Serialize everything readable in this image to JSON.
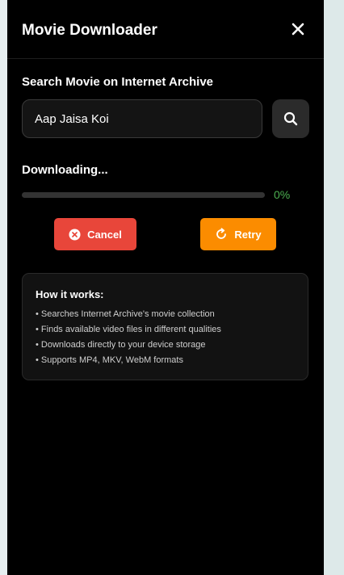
{
  "app": {
    "title": "Movie Downloader"
  },
  "search": {
    "label": "Search Movie on Internet Archive",
    "value": "Aap Jaisa Koi"
  },
  "download": {
    "status": "Downloading...",
    "progress_percent": 0,
    "progress_text": "0%"
  },
  "actions": {
    "cancel_label": "Cancel",
    "retry_label": "Retry"
  },
  "info": {
    "title": "How it works:",
    "items": [
      "• Searches Internet Archive's movie collection",
      "• Finds available video files in different qualities",
      "• Downloads directly to your device storage",
      "• Supports MP4, MKV, WebM formats"
    ]
  },
  "colors": {
    "panel_bg": "#000000",
    "cancel": "#e8463a",
    "retry": "#fb8c00",
    "progress": "#4caf50"
  },
  "icons": [
    "close-icon",
    "search-icon",
    "cancel-circle-icon",
    "retry-icon"
  ]
}
